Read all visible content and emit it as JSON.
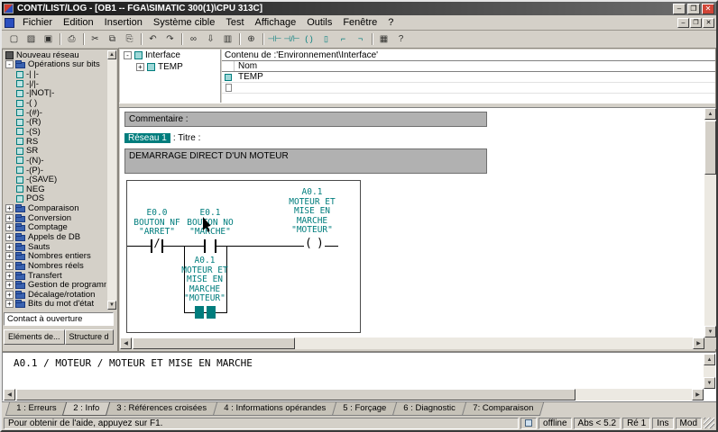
{
  "window": {
    "title": "CONT/LIST/LOG - [OB1 -- FGA\\SIMATIC 300(1)\\CPU 313C]",
    "controls": {
      "minimize": "–",
      "maximize": "❐",
      "close": "✕"
    },
    "child_controls": {
      "minimize": "–",
      "restore": "❐",
      "close": "✕"
    }
  },
  "glyphs": {
    "up": "▲",
    "down": "▼",
    "left": "◀",
    "right": "▶"
  },
  "menu": {
    "items": [
      "Fichier",
      "Edition",
      "Insertion",
      "Système cible",
      "Test",
      "Affichage",
      "Outils",
      "Fenêtre",
      "?"
    ]
  },
  "toolbar": {
    "icons": [
      {
        "name": "new-icon",
        "glyph": "▢"
      },
      {
        "name": "open-icon",
        "glyph": "▨"
      },
      {
        "name": "save-icon",
        "glyph": "▣"
      },
      {
        "type": "sep"
      },
      {
        "name": "print-icon",
        "glyph": "⎙"
      },
      {
        "type": "sep"
      },
      {
        "name": "cut-icon",
        "glyph": "✂"
      },
      {
        "name": "copy-icon",
        "glyph": "⧉"
      },
      {
        "name": "paste-icon",
        "glyph": "⎘"
      },
      {
        "type": "sep"
      },
      {
        "name": "undo-icon",
        "glyph": "↶"
      },
      {
        "name": "redo-icon",
        "glyph": "↷"
      },
      {
        "type": "sep"
      },
      {
        "name": "monitor-glasses-icon",
        "glyph": "∞"
      },
      {
        "name": "download-icon",
        "glyph": "⇩"
      },
      {
        "name": "hardware-icon",
        "glyph": "▥"
      },
      {
        "type": "sep"
      },
      {
        "name": "zoom-icon",
        "glyph": "⊕"
      },
      {
        "type": "sep"
      },
      {
        "name": "contact-no-icon",
        "glyph": "⊣⊢",
        "tone": "teal"
      },
      {
        "name": "contact-nc-icon",
        "glyph": "⊣/⊢",
        "tone": "teal"
      },
      {
        "name": "coil-icon",
        "glyph": "( )",
        "tone": "teal"
      },
      {
        "name": "box-icon",
        "glyph": "▯",
        "tone": "teal"
      },
      {
        "name": "open-branch-icon",
        "glyph": "⌐",
        "tone": "teal"
      },
      {
        "name": "close-branch-icon",
        "glyph": "¬",
        "tone": "teal"
      },
      {
        "type": "sep"
      },
      {
        "name": "new-network-icon",
        "glyph": "▦"
      },
      {
        "name": "help-icon",
        "glyph": "?"
      }
    ]
  },
  "sidebar": {
    "tree": [
      {
        "label": "Nouveau réseau",
        "kind": "net"
      },
      {
        "label": "Opérations sur bits",
        "kind": "open",
        "toggle": "-"
      },
      {
        "label": "-| |-",
        "kind": "leaf"
      },
      {
        "label": "-|/|-",
        "kind": "leaf"
      },
      {
        "label": "-|NOT|-",
        "kind": "leaf"
      },
      {
        "label": "-( )",
        "kind": "leaf"
      },
      {
        "label": "-(#)-",
        "kind": "leaf"
      },
      {
        "label": "-(R)",
        "kind": "leaf"
      },
      {
        "label": "-(S)",
        "kind": "leaf"
      },
      {
        "label": "RS",
        "kind": "leaf"
      },
      {
        "label": "SR",
        "kind": "leaf"
      },
      {
        "label": "-(N)-",
        "kind": "leaf"
      },
      {
        "label": "-(P)-",
        "kind": "leaf"
      },
      {
        "label": "-(SAVE)",
        "kind": "leaf"
      },
      {
        "label": "NEG",
        "kind": "leaf"
      },
      {
        "label": "POS",
        "kind": "leaf"
      },
      {
        "label": "Comparaison",
        "kind": "folder",
        "toggle": "+"
      },
      {
        "label": "Conversion",
        "kind": "folder",
        "toggle": "+"
      },
      {
        "label": "Comptage",
        "kind": "folder",
        "toggle": "+"
      },
      {
        "label": "Appels de DB",
        "kind": "folder",
        "toggle": "+"
      },
      {
        "label": "Sauts",
        "kind": "folder",
        "toggle": "+"
      },
      {
        "label": "Nombres entiers",
        "kind": "folder",
        "toggle": "+"
      },
      {
        "label": "Nombres réels",
        "kind": "folder",
        "toggle": "+"
      },
      {
        "label": "Transfert",
        "kind": "folder",
        "toggle": "+"
      },
      {
        "label": "Gestion de programme",
        "kind": "folder",
        "toggle": "+"
      },
      {
        "label": "Décalage/rotation",
        "kind": "folder",
        "toggle": "+"
      },
      {
        "label": "Bits du mot d'état",
        "kind": "folder",
        "toggle": "+"
      }
    ],
    "tooltip": "Contact à ouverture",
    "tabs": [
      {
        "label": "Eléments de...",
        "state": "active"
      },
      {
        "label": "Structure d",
        "state": "plain"
      }
    ]
  },
  "declaration": {
    "tree": {
      "root": "Interface",
      "root_toggle": "-",
      "child": "TEMP",
      "child_toggle": "+"
    },
    "table": {
      "header": "Contenu de :'Environnement\\Interface'",
      "column": "Nom",
      "row1": "TEMP"
    }
  },
  "editor": {
    "comment_label": "Commentaire :",
    "network_badge": "Réseau 1",
    "network_title_label": ": Titre :",
    "network_title": "DEMARRAGE DIRECT D'UN MOTEUR",
    "symbols": {
      "slash": "/",
      "paren_open": "(",
      "paren_close": ")"
    },
    "ladder": {
      "nc_contact": {
        "address": "E0.0",
        "desc": "BOUTON NF",
        "symbol": "\"ARRET\""
      },
      "no_contact": {
        "address": "E0.1",
        "desc": "BOUTON NO",
        "symbol": "\"MARCHE\""
      },
      "coil": {
        "address": "A0.1",
        "desc1": "MOTEUR ET",
        "desc2": "MISE EN",
        "desc3": "MARCHE",
        "symbol": "\"MOTEUR\""
      },
      "parallel_contact": {
        "address": "A0.1",
        "desc1": "MOTEUR ET",
        "desc2": "MISE EN",
        "desc3": "MARCHE",
        "symbol": "\"MOTEUR\""
      }
    }
  },
  "info_panel": {
    "text": "A0.1 / MOTEUR / MOTEUR ET MISE EN MARCHE"
  },
  "bottom_tabs": {
    "tabs": [
      {
        "label": "1 : Erreurs",
        "state": "plain"
      },
      {
        "label": "2 : Info",
        "state": "active"
      },
      {
        "label": "3 : Références croisées",
        "state": "plain"
      },
      {
        "label": "4 : Informations opérandes",
        "state": "plain"
      },
      {
        "label": "5 : Forçage",
        "state": "plain"
      },
      {
        "label": "6 : Diagnostic",
        "state": "plain"
      },
      {
        "label": "7: Comparaison",
        "state": "plain"
      }
    ]
  },
  "statusbar": {
    "help": "Pour obtenir de l'aide, appuyez sur F1.",
    "connection": "offline",
    "abs": "Abs < 5.2",
    "network": "Ré 1",
    "insert": "Ins",
    "mode": "Mod"
  }
}
